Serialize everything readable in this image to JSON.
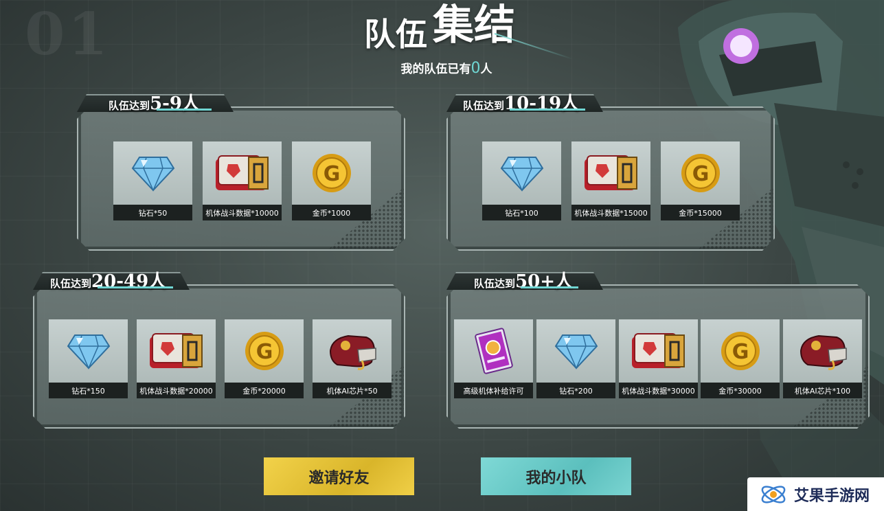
{
  "header": {
    "bg_number": "01",
    "title_part1": "队伍",
    "title_part2": "集结",
    "count_prefix": "我的队伍已有",
    "count_value": "0",
    "count_suffix": "人"
  },
  "tiers": [
    {
      "prefix": "队伍达到",
      "range": "5-9人",
      "rewards": [
        {
          "label": "钻石*50",
          "icon": "diamond-icon"
        },
        {
          "label": "机体战斗数据*10000",
          "icon": "battle-data-icon"
        },
        {
          "label": "金币*1000",
          "icon": "coin-icon"
        }
      ]
    },
    {
      "prefix": "队伍达到",
      "range": "10-19人",
      "rewards": [
        {
          "label": "钻石*100",
          "icon": "diamond-icon"
        },
        {
          "label": "机体战斗数据*15000",
          "icon": "battle-data-icon"
        },
        {
          "label": "金币*15000",
          "icon": "coin-icon"
        }
      ]
    },
    {
      "prefix": "队伍达到",
      "range": "20-49人",
      "rewards": [
        {
          "label": "钻石*150",
          "icon": "diamond-icon"
        },
        {
          "label": "机体战斗数据*20000",
          "icon": "battle-data-icon"
        },
        {
          "label": "金币*20000",
          "icon": "coin-icon"
        },
        {
          "label": "机体AI芯片*50",
          "icon": "ai-chip-icon"
        }
      ]
    },
    {
      "prefix": "队伍达到",
      "range": "50+人",
      "rewards": [
        {
          "label": "高级机体补给许可",
          "icon": "supply-permit-icon"
        },
        {
          "label": "钻石*200",
          "icon": "diamond-icon"
        },
        {
          "label": "机体战斗数据*30000",
          "icon": "battle-data-icon"
        },
        {
          "label": "金币*30000",
          "icon": "coin-icon"
        },
        {
          "label": "机体AI芯片*100",
          "icon": "ai-chip-icon"
        }
      ]
    }
  ],
  "buttons": {
    "invite": "邀请好友",
    "my_team": "我的小队"
  },
  "watermark": {
    "text": "艾果手游网"
  },
  "colors": {
    "accent_teal": "#6fd6d3",
    "invite_yellow": "#f2d24a",
    "team_teal": "#7fd9d6",
    "caption_bg": "#1c2120"
  }
}
